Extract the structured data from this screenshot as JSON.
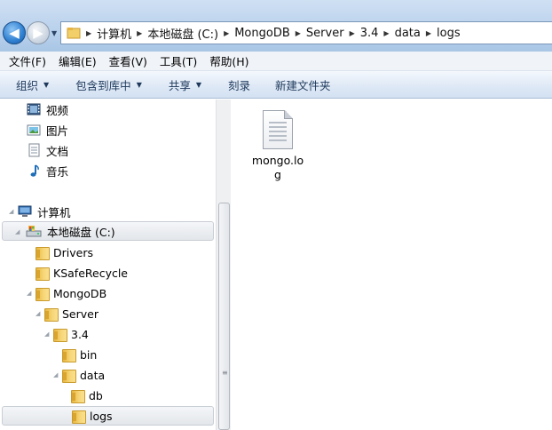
{
  "address_bar": {
    "breadcrumbs": [
      "计算机",
      "本地磁盘 (C:)",
      "MongoDB",
      "Server",
      "3.4",
      "data",
      "logs"
    ]
  },
  "menu": {
    "items": [
      "文件(F)",
      "编辑(E)",
      "查看(V)",
      "工具(T)",
      "帮助(H)"
    ]
  },
  "toolbar": {
    "organize": "组织",
    "include_in_library": "包含到库中",
    "share": "共享",
    "burn": "刻录",
    "new_folder": "新建文件夹"
  },
  "nav_tree": {
    "libraries": [
      {
        "label": "视频",
        "icon": "video-library-icon"
      },
      {
        "label": "图片",
        "icon": "pictures-library-icon"
      },
      {
        "label": "文档",
        "icon": "documents-library-icon"
      },
      {
        "label": "音乐",
        "icon": "music-library-icon"
      }
    ],
    "computer": "计算机",
    "drive": "本地磁盘 (C:)",
    "folders": [
      "Drivers",
      "KSafeRecycle",
      "MongoDB",
      "Server",
      "3.4",
      "bin",
      "data",
      "db",
      "logs"
    ]
  },
  "content": {
    "files": [
      {
        "name": "mongo.log",
        "icon": "text-file-icon"
      }
    ]
  }
}
